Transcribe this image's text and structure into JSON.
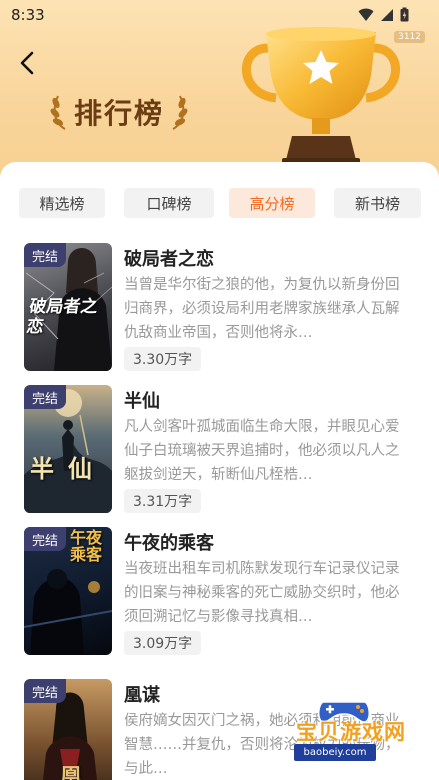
{
  "status": {
    "time": "8:33"
  },
  "header": {
    "title": "排行榜",
    "corner_badge": "3112"
  },
  "tabs": [
    {
      "label": "精选榜",
      "active": false
    },
    {
      "label": "口碑榜",
      "active": false
    },
    {
      "label": "高分榜",
      "active": true
    },
    {
      "label": "新书榜",
      "active": false
    }
  ],
  "books": [
    {
      "badge": "完结",
      "title": "破局者之恋",
      "description": "当曾是华尔街之狼的他，为复仇以新身份回归商界，必须设局利用老牌家族继承人瓦解仇敌商业帝国，否则他将永…",
      "words": "3.30万字",
      "cover_text": "破局者之恋"
    },
    {
      "badge": "完结",
      "title": "半仙",
      "description": "凡人剑客叶孤城面临生命大限，并眼见心爱仙子白琉璃被天界追捕时，他必须以凡人之躯拔剑逆天，斩断仙凡桎梏…",
      "words": "3.31万字",
      "cover_text": "半仙"
    },
    {
      "badge": "完结",
      "title": "午夜的乘客",
      "description": "当夜班出租车司机陈默发现行车记录仪记录的旧案与神秘乘客的死亡威胁交织时，他必须回溯记忆与影像寻找真相…",
      "words": "3.09万字",
      "cover_text": "午夜乘客"
    },
    {
      "badge": "完结",
      "title": "凰谋",
      "description": "侯府嫡女因灭门之祸，她必须利用前世商业智慧……并复仇，否则将沦为权力的玩物，与此…",
      "words": "",
      "cover_text": "凰"
    }
  ],
  "watermark": {
    "text": "宝贝游戏网",
    "url": "baobeiy.com"
  },
  "colors": {
    "accent": "#f26a22",
    "header_bg": "#f9d59b",
    "title_brown": "#6a3d14",
    "badge_bg": "#3d3f6e"
  }
}
